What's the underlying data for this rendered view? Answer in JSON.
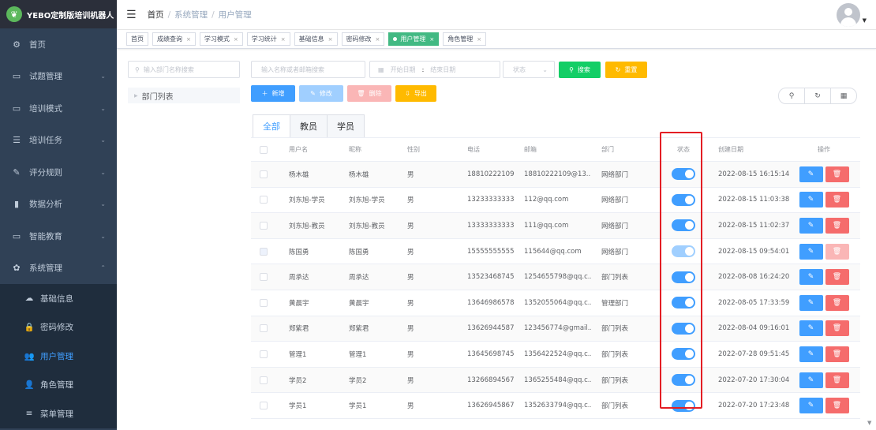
{
  "app": {
    "logo_text": "YEBO定制版培训机器人",
    "logo_icon": "leaf-icon"
  },
  "sidebar": {
    "menus": [
      {
        "label": "首页",
        "icon": "dashboard-icon",
        "arrow": ""
      },
      {
        "label": "试题管理",
        "icon": "book-icon",
        "arrow": "⌄"
      },
      {
        "label": "培训模式",
        "icon": "monitor-icon",
        "arrow": "⌄"
      },
      {
        "label": "培训任务",
        "icon": "list-icon",
        "arrow": "⌄"
      },
      {
        "label": "评分规则",
        "icon": "edit-icon",
        "arrow": "⌄"
      },
      {
        "label": "数据分析",
        "icon": "bar-chart-icon",
        "arrow": "⌄"
      },
      {
        "label": "智能教育",
        "icon": "screen-icon",
        "arrow": "⌄"
      },
      {
        "label": "系统管理",
        "icon": "gear-icon",
        "arrow": "⌃"
      }
    ],
    "sub_items": [
      {
        "label": "基础信息",
        "icon": "chat-icon"
      },
      {
        "label": "密码修改",
        "icon": "lock-icon"
      },
      {
        "label": "用户管理",
        "icon": "users-icon",
        "active": true
      },
      {
        "label": "角色管理",
        "icon": "user-icon"
      },
      {
        "label": "菜单管理",
        "icon": "menu-icon"
      }
    ]
  },
  "header": {
    "breadcrumb": [
      "首页",
      "系统管理",
      "用户管理"
    ],
    "separator": "/"
  },
  "tags": [
    {
      "label": "首页",
      "closable": false,
      "active": false
    },
    {
      "label": "成绩查询",
      "closable": true,
      "active": false
    },
    {
      "label": "学习模式",
      "closable": true,
      "active": false
    },
    {
      "label": "学习统计",
      "closable": true,
      "active": false
    },
    {
      "label": "基础信息",
      "closable": true,
      "active": false
    },
    {
      "label": "密码修改",
      "closable": true,
      "active": false
    },
    {
      "label": "用户管理",
      "closable": true,
      "active": true
    },
    {
      "label": "角色管理",
      "closable": true,
      "active": false
    }
  ],
  "left": {
    "dept_search_placeholder": "输入部门名称搜索",
    "tree_root": "部门列表"
  },
  "filters": {
    "name_placeholder": "输入名称或者邮箱搜索",
    "start_date_placeholder": "开始日期",
    "range_separator": ":",
    "end_date_placeholder": "结束日期",
    "status_placeholder": "状态",
    "search_label": "搜索",
    "reset_label": "重置"
  },
  "toolbar": {
    "add": "新增",
    "edit": "修改",
    "delete": "删除",
    "export": "导出"
  },
  "tabs": [
    "全部",
    "教员",
    "学员"
  ],
  "table": {
    "columns": [
      "用户名",
      "昵称",
      "性别",
      "电话",
      "邮箱",
      "部门",
      "状态",
      "创建日期",
      "操作"
    ],
    "rows": [
      {
        "username": "杨木雄",
        "nickname": "杨木雄",
        "gender": "男",
        "phone": "18810222109",
        "email": "18810222109@13...",
        "dept": "网络部门",
        "enabled": true,
        "disabled_toggle": false,
        "created": "2022-08-15 16:15:14"
      },
      {
        "username": "刘东旭-学员",
        "nickname": "刘东旭-学员",
        "gender": "男",
        "phone": "13233333333",
        "email": "112@qq.com",
        "dept": "网络部门",
        "enabled": true,
        "disabled_toggle": false,
        "created": "2022-08-15 11:03:38"
      },
      {
        "username": "刘东旭-教员",
        "nickname": "刘东旭-教员",
        "gender": "男",
        "phone": "13333333333",
        "email": "111@qq.com",
        "dept": "网络部门",
        "enabled": true,
        "disabled_toggle": false,
        "created": "2022-08-15 11:02:37"
      },
      {
        "username": "陈国勇",
        "nickname": "陈国勇",
        "gender": "男",
        "phone": "15555555555",
        "email": "115644@qq.com",
        "dept": "网络部门",
        "enabled": true,
        "disabled_toggle": true,
        "created": "2022-08-15 09:54:01"
      },
      {
        "username": "周承达",
        "nickname": "周承达",
        "gender": "男",
        "phone": "13523468745",
        "email": "1254655798@qq.c...",
        "dept": "部门列表",
        "enabled": true,
        "disabled_toggle": false,
        "created": "2022-08-08 16:24:20"
      },
      {
        "username": "黄晨宇",
        "nickname": "黄晨宇",
        "gender": "男",
        "phone": "13646986578",
        "email": "1352055064@qq.c...",
        "dept": "管理部门",
        "enabled": true,
        "disabled_toggle": false,
        "created": "2022-08-05 17:33:59"
      },
      {
        "username": "郑紫君",
        "nickname": "郑紫君",
        "gender": "男",
        "phone": "13626944587",
        "email": "123456774@gmail...",
        "dept": "部门列表",
        "enabled": true,
        "disabled_toggle": false,
        "created": "2022-08-04 09:16:01"
      },
      {
        "username": "管理1",
        "nickname": "管理1",
        "gender": "男",
        "phone": "13645698745",
        "email": "1356422524@qq.c...",
        "dept": "部门列表",
        "enabled": true,
        "disabled_toggle": false,
        "created": "2022-07-28 09:51:45"
      },
      {
        "username": "学员2",
        "nickname": "学员2",
        "gender": "男",
        "phone": "13266894567",
        "email": "1365255484@qq.c...",
        "dept": "部门列表",
        "enabled": true,
        "disabled_toggle": false,
        "created": "2022-07-20 17:30:04"
      },
      {
        "username": "学员1",
        "nickname": "学员1",
        "gender": "男",
        "phone": "13626945867",
        "email": "1352633794@qq.c...",
        "dept": "部门列表",
        "enabled": true,
        "disabled_toggle": false,
        "created": "2022-07-20 17:23:48"
      }
    ]
  },
  "colors": {
    "sidebar_bg": "#304156",
    "primary": "#409eff",
    "success": "#13ce66",
    "warning": "#ffba00",
    "danger": "#f56c6c",
    "active_tag": "#42b983",
    "highlight_box": "#e31e24"
  }
}
